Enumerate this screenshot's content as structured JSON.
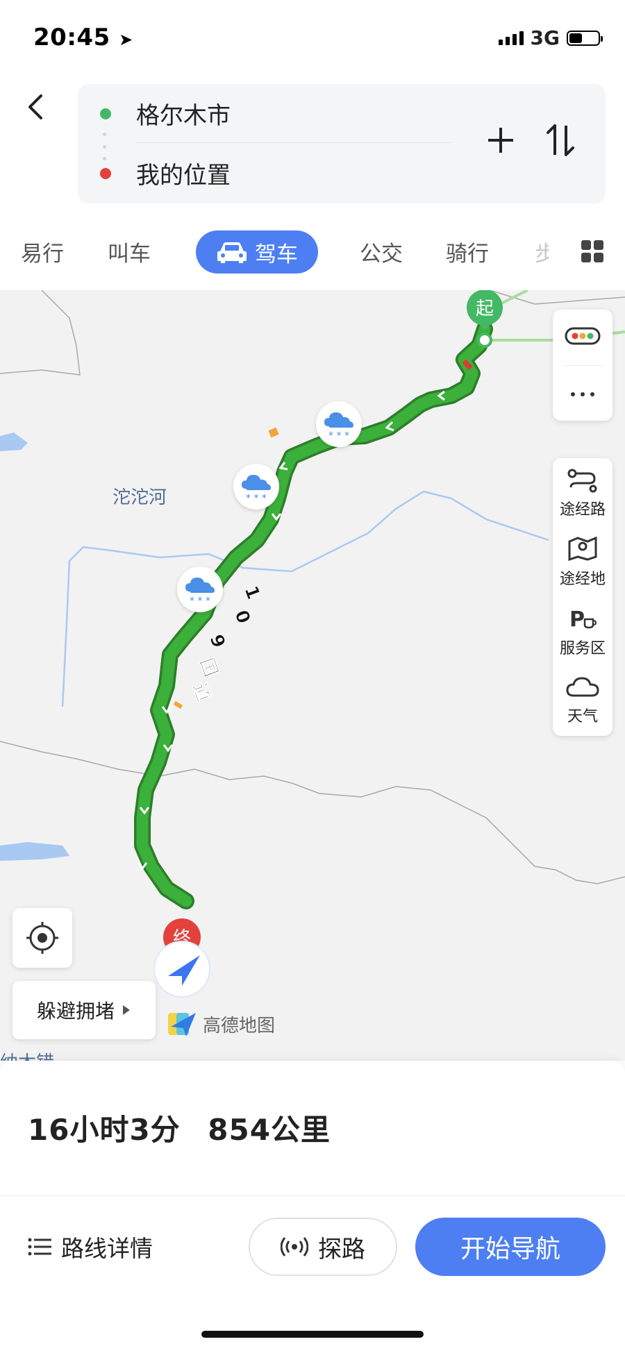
{
  "status_bar": {
    "time": "20:45",
    "network": "3G",
    "battery_level": 0.45
  },
  "route": {
    "origin": "格尔木市",
    "destination": "我的位置",
    "add_label": "+",
    "swap_label": "⇅"
  },
  "modes": {
    "items": [
      "易行",
      "叫车",
      "驾车",
      "公交",
      "骑行",
      "步"
    ],
    "selected": "驾车"
  },
  "map": {
    "road_label": "109国道",
    "place_labels": [
      "沱沱河",
      "纳木错"
    ],
    "start_marker": "起",
    "end_marker": "终",
    "brand": "高德地图",
    "avoid_congestion": "躲避拥堵",
    "route_color": "#3bb03a",
    "side_panel": {
      "traffic_icon": "traffic-light-icon",
      "more_icon": "more-dots-icon",
      "items": [
        {
          "label": "途经路",
          "icon": "route-waypoint-icon"
        },
        {
          "label": "途经地",
          "icon": "map-pin-icon"
        },
        {
          "label": "服务区",
          "icon": "service-area-icon"
        },
        {
          "label": "天气",
          "icon": "cloud-icon"
        }
      ]
    }
  },
  "summary": {
    "duration": "16小时3分",
    "distance": "854公里"
  },
  "actions": {
    "details": "路线详情",
    "explore": "探路",
    "start": "开始导航"
  },
  "colors": {
    "accent": "#4d7ff3",
    "origin_dot": "#43b865",
    "destination_dot": "#e2423b"
  }
}
